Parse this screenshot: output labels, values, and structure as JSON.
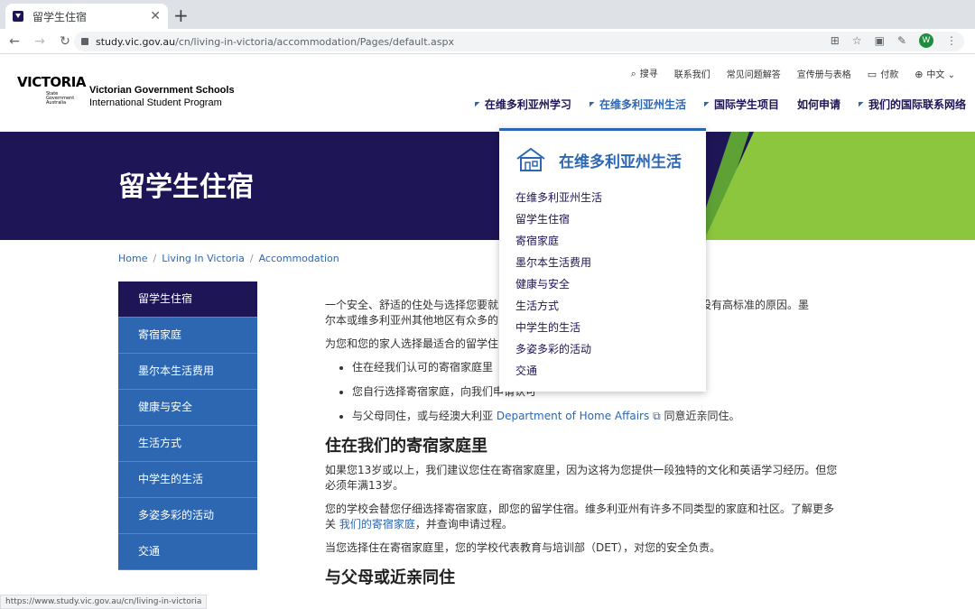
{
  "browser": {
    "tab_title": "留学生住宿",
    "tab_close": "✕",
    "new_tab": "+",
    "url_host": "study.vic.gov.au",
    "url_path": "/cn/living-in-victoria/accommodation/Pages/default.aspx",
    "avatar_letter": "W",
    "status_url": "https://www.study.vic.gov.au/cn/living-in-victoria"
  },
  "logo": {
    "main": "VICTORIA",
    "sub1": "State",
    "sub2": "Government",
    "sub3": "Australia",
    "title_line1": "Victorian Government Schools",
    "title_line2": "International Student Program"
  },
  "utility": {
    "search": "搜寻",
    "contact": "联系我们",
    "faq": "常见问题解答",
    "brochures": "宣传册与表格",
    "pay": "付款",
    "lang": "中文"
  },
  "mainnav": [
    "在维多利亚州学习",
    "在维多利亚州生活",
    "国际学生项目",
    "如何申请",
    "我们的国际联系网络"
  ],
  "hero": {
    "title": "留学生住宿",
    "colors": {
      "navy": "#1d1556",
      "green": "#8cc63f"
    }
  },
  "breadcrumb": [
    "Home",
    "Living In Victoria",
    "Accommodation"
  ],
  "sidenav": [
    "留学生住宿",
    "寄宿家庭",
    "墨尔本生活费用",
    "健康与安全",
    "生活方式",
    "中学生的生活",
    "多姿多彩的活动",
    "交通"
  ],
  "dropdown": {
    "title": "在维多利亚州生活",
    "items": [
      "在维多利亚州生活",
      "留学生住宿",
      "寄宿家庭",
      "墨尔本生活费用",
      "健康与安全",
      "生活方式",
      "中学生的生活",
      "多姿多彩的活动",
      "交通"
    ]
  },
  "content": {
    "p1a": "一个安全、舒适的住处与选择您要就",
    "p1b": "宿都设有高标准的原因。墨",
    "p1c": "尔本或维多利亚州其他地区有众多的",
    "p2": "为您和您的家人选择最适合的留学住",
    "li1": "住在经我们认可的寄宿家庭里",
    "li2": "您自行选择寄宿家庭，向我们申请认可",
    "li3_pre": "与父母同住，或与经澳大利亚 ",
    "li3_link": "Department of Home Affairs",
    "li3_post": " 同意近亲同住。",
    "h1": "住在我们的寄宿家庭里",
    "p3": "如果您13岁或以上，我们建议您住在寄宿家庭里，因为这将为您提供一段独特的文化和英语学习经历。但您必须年满13岁。",
    "p4_pre": "您的学校会替您仔细选择寄宿家庭，即您的留学住宿。维多利亚州有许多不同类型的家庭和社区。了解更多关 ",
    "p4_link": "我们的寄宿家庭",
    "p4_post": "，并查询申请过程。",
    "p5": "当您选择住在寄宿家庭里，您的学校代表教育与培训部（DET），对您的安全负责。",
    "h2": "与父母或近亲同住"
  }
}
